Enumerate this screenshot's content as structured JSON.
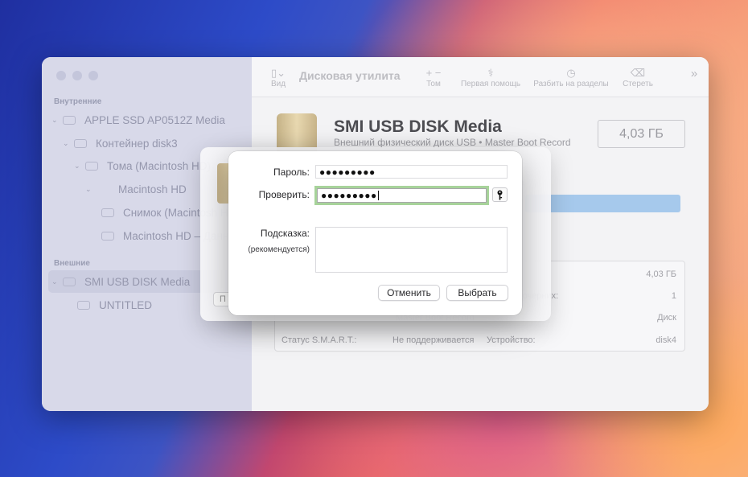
{
  "window": {
    "title": "Дисковая утилита"
  },
  "toolbar": {
    "view": "Вид",
    "volume": "Том",
    "first_aid": "Первая помощь",
    "partition": "Разбить на разделы",
    "erase": "Стереть"
  },
  "sidebar": {
    "internal_header": "Внутренние",
    "external_header": "Внешние",
    "items": [
      {
        "label": "APPLE SSD AP0512Z Media"
      },
      {
        "label": "Контейнер disk3"
      },
      {
        "label": "Тома (Macintosh HD)"
      },
      {
        "label": "Macintosh HD"
      },
      {
        "label": "Снимок (Macintosh HD)"
      },
      {
        "label": "Macintosh HD – Данные"
      },
      {
        "label": "SMI USB DISK Media"
      },
      {
        "label": "UNTITLED"
      }
    ]
  },
  "disk": {
    "name": "SMI USB DISK Media",
    "subtitle": "Внешний физический диск USB • Master Boot Record",
    "size": "4,03 ГБ"
  },
  "info_table": {
    "size_value": "4,03 ГБ",
    "children_label": "Дочерних:",
    "children_value": "1",
    "scheme_value": "Master Boot Record",
    "type_value": "Диск",
    "smart_label": "Статус S.M.A.R.T.:",
    "smart_value": "Не поддерживается",
    "device_label": "Устройство:",
    "device_value": "disk4"
  },
  "sheet": {
    "partial_button": "П"
  },
  "dialog": {
    "password_label": "Пароль:",
    "password_value": "●●●●●●●●●",
    "verify_label": "Проверить:",
    "verify_value": "●●●●●●●●●",
    "hint_label": "Подсказка:",
    "hint_sub": "(рекомендуется)",
    "cancel": "Отменить",
    "choose": "Выбрать"
  },
  "colors": {
    "focus_ring": "#a7d39a",
    "partition_bar": "#a6c9ec"
  }
}
